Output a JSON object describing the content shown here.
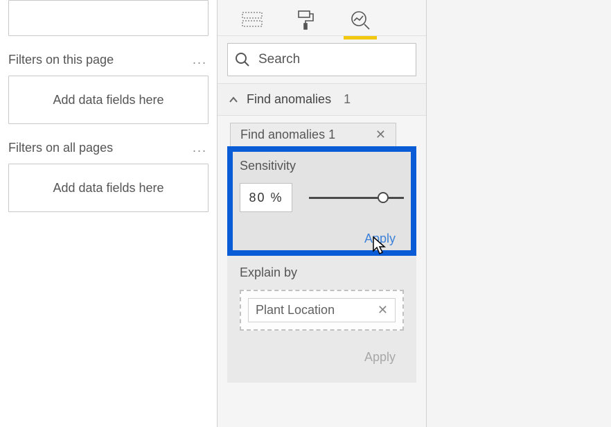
{
  "filters": {
    "thisPage": {
      "title": "Filters on this page",
      "placeholder": "Add data fields here"
    },
    "allPages": {
      "title": "Filters on all pages",
      "placeholder": "Add data fields here"
    }
  },
  "analytics": {
    "search_placeholder": "Search",
    "section": {
      "title": "Find anomalies",
      "count": "1"
    },
    "cardTab": {
      "label": "Find anomalies 1"
    },
    "sensitivity": {
      "label": "Sensitivity",
      "value": "80  %",
      "apply": "Apply",
      "slider_pct": "78"
    },
    "explain": {
      "label": "Explain by",
      "chip": "Plant Location",
      "apply": "Apply"
    }
  }
}
